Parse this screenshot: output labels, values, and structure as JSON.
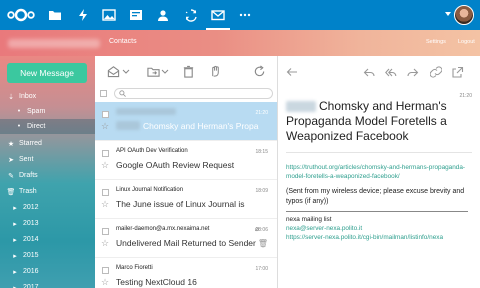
{
  "topnav": {
    "apps": [
      {
        "icon": "files-icon"
      },
      {
        "icon": "activity-icon"
      },
      {
        "icon": "gallery-icon"
      },
      {
        "icon": "news-icon"
      },
      {
        "icon": "contacts-icon"
      },
      {
        "icon": "sync-icon"
      },
      {
        "icon": "mail-icon",
        "active": true
      },
      {
        "icon": "more-icon"
      }
    ],
    "accent_color": "#0082c9"
  },
  "header": {
    "contacts": "Contacts",
    "settings": "Settings",
    "logout": "Logout"
  },
  "sidebar": {
    "new_message": "New Message",
    "nav": [
      {
        "label": "Inbox",
        "icon": "inbox-icon"
      },
      {
        "label": "Spam",
        "icon": "dot-icon"
      },
      {
        "label": "Direct",
        "icon": "dot-icon"
      },
      {
        "label": "Starred",
        "icon": "star-icon"
      },
      {
        "label": "Sent",
        "icon": "sent-icon"
      },
      {
        "label": "Drafts",
        "icon": "drafts-icon"
      },
      {
        "label": "Trash",
        "icon": "trash-icon"
      },
      {
        "label": "2012",
        "icon": "folder-icon"
      },
      {
        "label": "2013",
        "icon": "folder-icon"
      },
      {
        "label": "2014",
        "icon": "folder-icon"
      },
      {
        "label": "2015",
        "icon": "folder-icon"
      },
      {
        "label": "2016",
        "icon": "folder-icon"
      },
      {
        "label": "2017",
        "icon": "folder-icon"
      }
    ]
  },
  "list": {
    "messages": [
      {
        "from": "",
        "subject": "Chomsky and Herman's Propa",
        "time": "21:20"
      },
      {
        "from": "API OAuth Dev Verification",
        "subject": "Google OAuth Review Request",
        "time": "18:15"
      },
      {
        "from": "Linux Journal Notification",
        "subject": "The June issue of Linux Journal is",
        "time": "18:09"
      },
      {
        "from": "mailer-daemon@a.mx.nexaima.net",
        "subject": "Undelivered Mail Returned to Sender",
        "time": "18:06"
      },
      {
        "from": "Marco Fioretti",
        "subject": "Testing NextCloud 16",
        "time": "17:00"
      }
    ]
  },
  "reader": {
    "time": "21:20",
    "subject": "Chomsky and Herman's Propaganda Model Foretells a Weaponized Facebook",
    "link": "https://truthout.org/articles/chomsky-and-hermans-propaganda-model-foretells-a-weaponized-facebook/",
    "note": "(Sent from my wireless device; please excuse brevity and typos (if any))",
    "list_name": "nexa mailing list",
    "list_email": "nexa@server-nexa.polito.it",
    "list_url": "https://server-nexa.polito.it/cgi-bin/mailman/listinfo/nexa"
  }
}
